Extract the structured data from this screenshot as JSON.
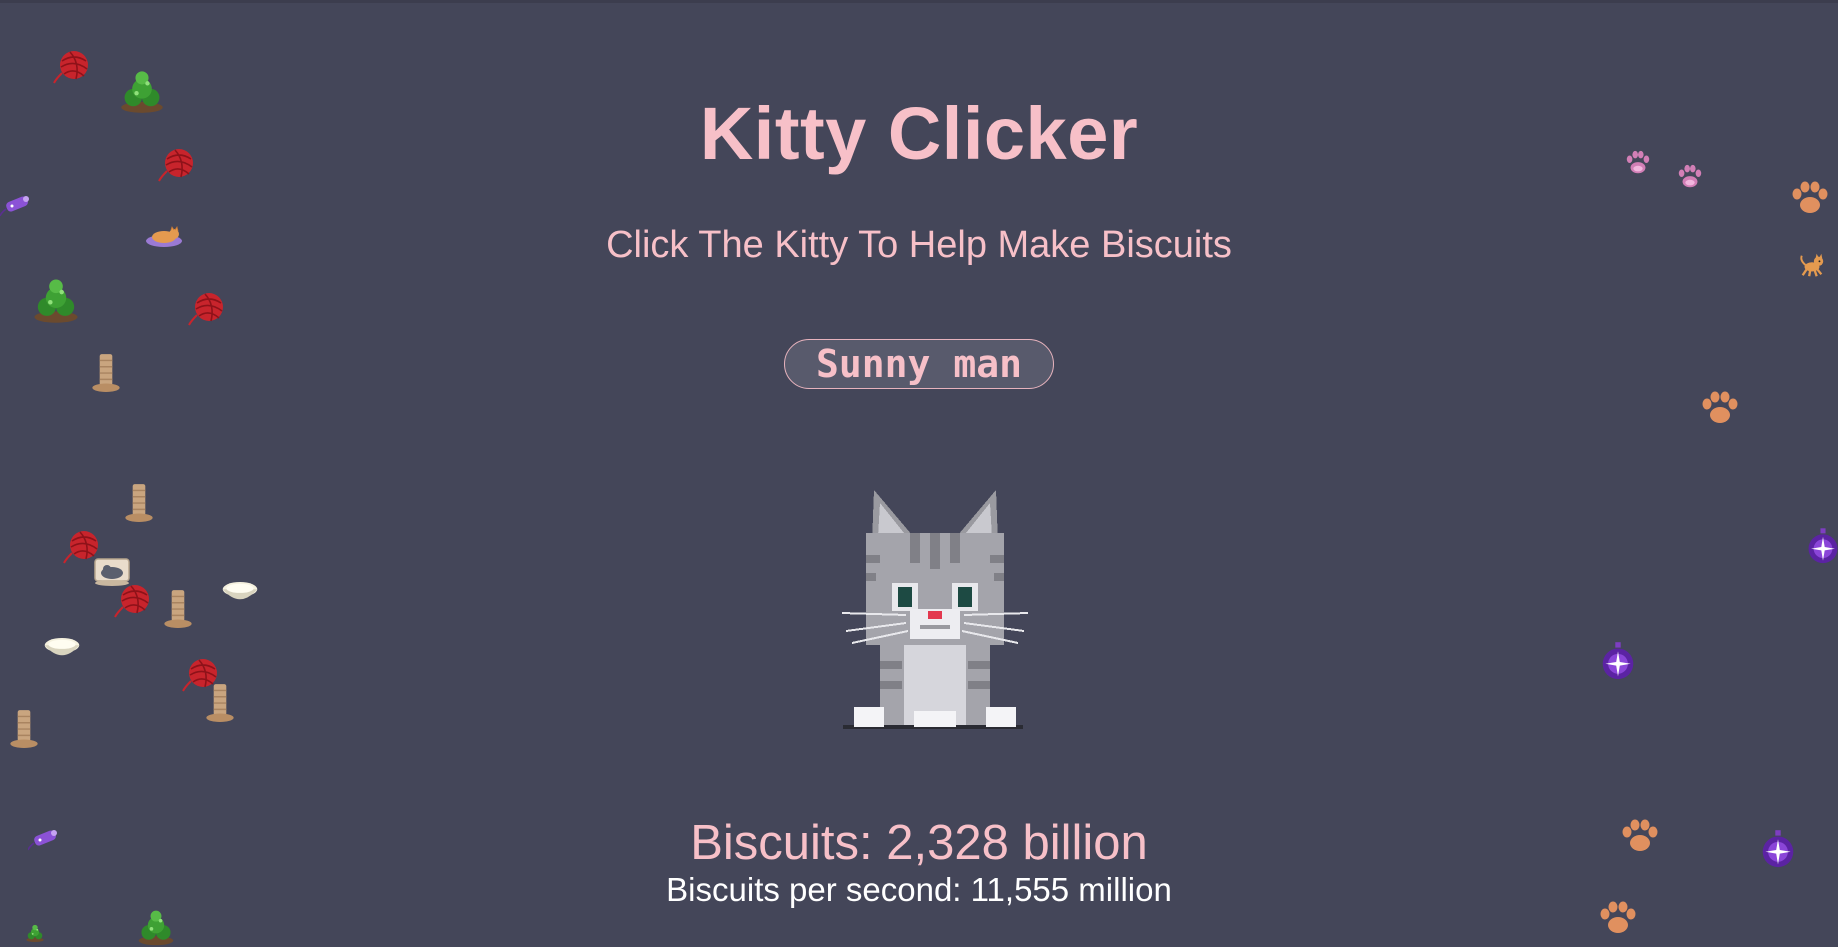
{
  "app": {
    "title": "Kitty Clicker",
    "subtitle": "Click The Kitty To Help Make Biscuits"
  },
  "player": {
    "name_value": "Sunny man"
  },
  "kitty": {
    "icon": "pixel-tabby-cat-icon"
  },
  "stats": {
    "biscuits_label": "Biscuits: 2,328 billion",
    "per_second_label": "Biscuits per second: 11,555 million"
  },
  "decorations": {
    "left": [
      "yarn-ball-icon",
      "catnip-plant-icon",
      "scratching-post-icon",
      "food-bowl-icon",
      "toy-mouse-icon",
      "sleeping-cat-icon",
      "cat-bed-icon"
    ],
    "right": [
      "pink-paw-icon",
      "orange-paw-icon",
      "purple-orb-icon",
      "running-cat-icon"
    ]
  },
  "colors": {
    "background": "#444659",
    "accent_pink": "#f7c0c8",
    "stats_white": "#ffffff"
  }
}
